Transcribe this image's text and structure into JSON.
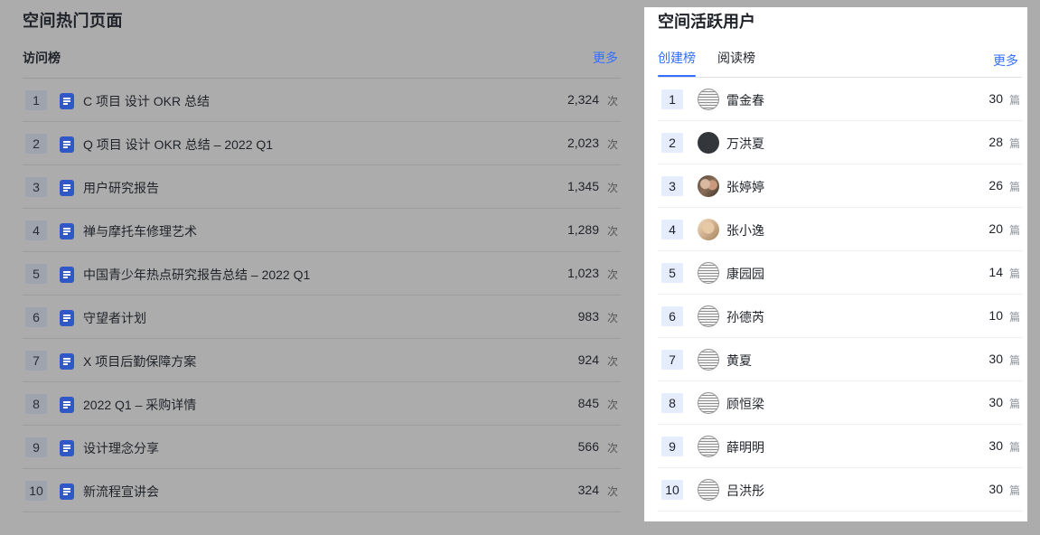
{
  "hot_pages": {
    "title": "空间热门页面",
    "subtitle": "访问榜",
    "more_label": "更多",
    "unit": "次",
    "items": [
      {
        "rank": "1",
        "title": "C 项目 设计 OKR 总结",
        "count": "2,324"
      },
      {
        "rank": "2",
        "title": "Q 项目 设计 OKR 总结 – 2022 Q1",
        "count": "2,023"
      },
      {
        "rank": "3",
        "title": "用户研究报告",
        "count": "1,345"
      },
      {
        "rank": "4",
        "title": "禅与摩托车修理艺术",
        "count": "1,289"
      },
      {
        "rank": "5",
        "title": "中国青少年热点研究报告总结 – 2022 Q1",
        "count": "1,023"
      },
      {
        "rank": "6",
        "title": "守望者计划",
        "count": "983"
      },
      {
        "rank": "7",
        "title": "X 项目后勤保障方案",
        "count": "924"
      },
      {
        "rank": "8",
        "title": "2022 Q1 – 采购详情",
        "count": "845"
      },
      {
        "rank": "9",
        "title": "设计理念分享",
        "count": "566"
      },
      {
        "rank": "10",
        "title": "新流程宣讲会",
        "count": "324"
      }
    ]
  },
  "active_users": {
    "title": "空间活跃用户",
    "tabs": [
      {
        "label": "创建榜",
        "active": true
      },
      {
        "label": "阅读榜",
        "active": false
      }
    ],
    "more_label": "更多",
    "unit": "篇",
    "items": [
      {
        "rank": "1",
        "name": "雷金春",
        "count": "30",
        "avatar": "striped"
      },
      {
        "rank": "2",
        "name": "万洪夏",
        "count": "28",
        "avatar": "dark"
      },
      {
        "rank": "3",
        "name": "张婷婷",
        "count": "26",
        "avatar": "photo1"
      },
      {
        "rank": "4",
        "name": "张小逸",
        "count": "20",
        "avatar": "photo2"
      },
      {
        "rank": "5",
        "name": "康园园",
        "count": "14",
        "avatar": "striped"
      },
      {
        "rank": "6",
        "name": "孙德芮",
        "count": "10",
        "avatar": "striped"
      },
      {
        "rank": "7",
        "name": "黄夏",
        "count": "30",
        "avatar": "striped"
      },
      {
        "rank": "8",
        "name": "顾恒梁",
        "count": "30",
        "avatar": "striped"
      },
      {
        "rank": "9",
        "name": "薛明明",
        "count": "30",
        "avatar": "striped"
      },
      {
        "rank": "10",
        "name": "吕洪彤",
        "count": "30",
        "avatar": "striped"
      }
    ]
  },
  "colors": {
    "accent": "#3370ff",
    "overlay": "#acacac",
    "doc_icon": "#3058c8"
  }
}
